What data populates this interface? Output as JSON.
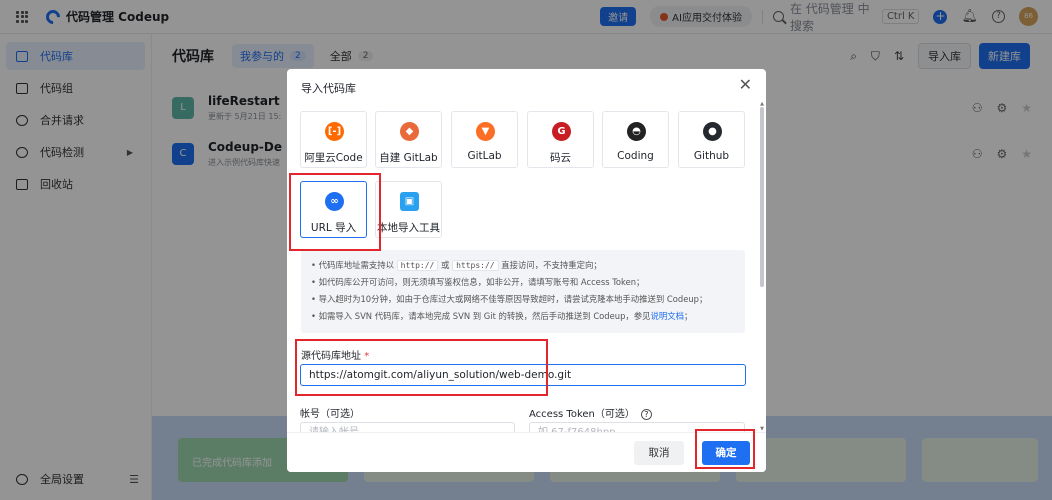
{
  "topbar": {
    "app_title": "代码管理 Codeup",
    "invite_label": "邀请",
    "ai_label": "AI应用交付体验",
    "search_placeholder": "在 代码管理 中搜索",
    "shortcut": "Ctrl K",
    "avatar_text": "86"
  },
  "sidebar": {
    "items": [
      {
        "label": "代码库",
        "icon": "repo-icon"
      },
      {
        "label": "代码组",
        "icon": "folder-icon"
      },
      {
        "label": "合并请求",
        "icon": "merge-icon"
      },
      {
        "label": "代码检测",
        "icon": "scan-icon"
      },
      {
        "label": "回收站",
        "icon": "trash-icon"
      }
    ],
    "settings_label": "全局设置"
  },
  "main": {
    "title": "代码库",
    "tabs": [
      {
        "label": "我参与的",
        "count": "2"
      },
      {
        "label": "全部",
        "count": "2"
      }
    ],
    "import_label": "导入库",
    "new_label": "新建库",
    "repos": [
      {
        "avatar": "L",
        "name": "lifeRestart",
        "sub": "更新于 5月21日 15:",
        "color": "#5fb8a8"
      },
      {
        "avatar": "C",
        "name": "Codeup-De",
        "sub": "进入示例代码库快速",
        "color": "#1e6ff1"
      }
    ],
    "band_text": "已完成代码库添加"
  },
  "modal": {
    "title": "导入代码库",
    "sources": [
      {
        "label": "阿里云Code",
        "icon": "aliyun-icon",
        "color": "#ff6a00"
      },
      {
        "label": "自建 GitLab",
        "icon": "gitlab-self-icon",
        "color": "#e86a3a"
      },
      {
        "label": "GitLab",
        "icon": "gitlab-icon",
        "color": "#fc6d26"
      },
      {
        "label": "码云",
        "icon": "gitee-icon",
        "color": "#c71d23"
      },
      {
        "label": "Coding",
        "icon": "coding-icon",
        "color": "#222222"
      },
      {
        "label": "Github",
        "icon": "github-icon",
        "color": "#24292f"
      },
      {
        "label": "URL 导入",
        "icon": "link-icon",
        "color": "#1e6ff1"
      },
      {
        "label": "本地导入工具",
        "icon": "local-tool-icon",
        "color": "#2aa1f0"
      }
    ],
    "tips": {
      "t1_a": "• 代码库地址需支持以",
      "t1_http": "http://",
      "t1_or": "或",
      "t1_https": "https://",
      "t1_b": "直接访问，不支持重定向；",
      "t2": "• 如代码库公开可访问，则无须填写鉴权信息，如非公开，请填写账号和 Access Token；",
      "t3": "• 导入超时为10分钟，如由于仓库过大或网络不佳等原因导致超时，请尝试克隆本地手动推送到 Codeup；",
      "t4_a": "• 如需导入 SVN 代码库，请本地完成 SVN 到 Git 的转换，然后手动推送到 Codeup，参见",
      "t4_link": "说明文档",
      "t4_end": "；"
    },
    "url_label": "源代码库地址",
    "url_required": "*",
    "url_value": "https://atomgit.com/aliyun_solution/web-demo.git",
    "account_label": "帐号（可选）",
    "account_placeholder": "请输入帐号",
    "token_label": "Access Token（可选）",
    "token_placeholder": "如 67-f7648hpp",
    "cancel_label": "取消",
    "ok_label": "确定"
  }
}
